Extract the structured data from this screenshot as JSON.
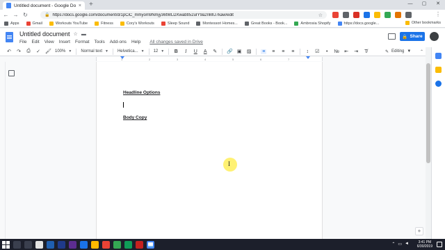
{
  "browser": {
    "tab_title": "Untitled document - Google Do",
    "tab_close": "×",
    "new_tab": "+",
    "window_controls": [
      "—",
      "▢",
      "✕"
    ],
    "url": "https://docs.google.com/document/d/1pCiC_mmyom9Nmjy36tWLDXwabtI52uIY9a2nMIJ7kaw/edit",
    "bookmarks": [
      {
        "label": "Apps",
        "color": "#5f6368"
      },
      {
        "label": "Gmail",
        "color": "#ea4335"
      },
      {
        "label": "Workouts YouTube",
        "color": "#fbbc04"
      },
      {
        "label": "Fitness",
        "color": "#fbbc04"
      },
      {
        "label": "Cory's Workouts",
        "color": "#fbbc04"
      },
      {
        "label": "Sleep Sound",
        "color": "#ea4335"
      },
      {
        "label": "Montessori Homes...",
        "color": "#5f6368"
      },
      {
        "label": "Great Books - Book...",
        "color": "#5f6368"
      },
      {
        "label": "Ambrosia Shopify",
        "color": "#34a853"
      },
      {
        "label": "https://docs.google...",
        "color": "#4285f4"
      }
    ],
    "other_bookmarks": "Other bookmarks",
    "extension_colors": [
      "#ea4335",
      "#5f6368",
      "#d93025",
      "#1a73e8",
      "#fbbc04",
      "#34a853",
      "#e37400",
      "#5f6368"
    ]
  },
  "docs": {
    "title": "Untitled document",
    "menu": [
      "File",
      "Edit",
      "View",
      "Insert",
      "Format",
      "Tools",
      "Add-ons",
      "Help"
    ],
    "saved_status": "All changes saved in Drive",
    "share_label": "Share",
    "toolbar": {
      "zoom": "100%",
      "style": "Normal text",
      "font": "Helvetica...",
      "size": "12",
      "mode": "Editing"
    },
    "ruler_ticks": [
      "1",
      "2",
      "3",
      "4",
      "5",
      "6",
      "7"
    ],
    "content": {
      "heading_1": "Headline Options",
      "heading_2": "Body Copy"
    }
  },
  "taskbar": {
    "time": "3:41 PM",
    "date": "6/30/2019",
    "app_colors": [
      "#3a3f4e",
      "#3a3f4e",
      "#e3e3e3",
      "#1f5fb0",
      "#1f3a8a",
      "#5c2d91",
      "#1a73e8",
      "#ffb900",
      "#ea4335",
      "#34a853",
      "#0f9d58",
      "#c5221f",
      "#ffffff"
    ]
  }
}
